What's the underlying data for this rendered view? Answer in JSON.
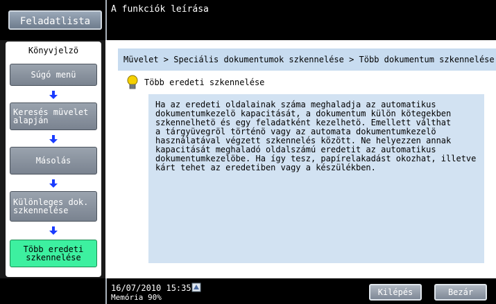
{
  "header": {
    "tasklist_label": "Feladatlista",
    "title": "A funkciók leírása"
  },
  "sidebar": {
    "bookmark_label": "Könyvjelzö",
    "items": [
      {
        "label": "Súgó menü"
      },
      {
        "label": "Keresés müvelet alapján"
      },
      {
        "label": "Másolás"
      },
      {
        "label": "Különleges dok. szkennelése"
      },
      {
        "label": "Több eredeti szkennelése"
      }
    ]
  },
  "main": {
    "breadcrumb": "Müvelet > Speciális dokumentumok szkennelése > Több dokumentum szkennelése",
    "topic_title": "Több eredeti szkennelése",
    "description": "Ha az eredeti oldalainak száma meghaladja az automatikus\ndokumentumkezelö kapacitását, a dokumentum külön kötegekben\nszkennelhetö és egy feladatként kezelhetö. Emellett válthat\na tárgyüvegröl történö vagy az automata dokumentumkezelö\nhasználatával végzett szkennelés között. Ne helyezzen annak\nkapacitását meghaladó oldalszámú eredetit az automatikus\ndokumentumkezelöbe. Ha így tesz, papírelakadást okozhat, illetve\nkárt tehet az eredetiben vagy a készülékben."
  },
  "footer": {
    "datetime": "16/07/2010   15:35",
    "memory": "Memória     90%",
    "exit_label": "Kilépés",
    "close_label": "Bezár"
  },
  "colors": {
    "active_nav": "#3df0a0",
    "breadcrumb_bg": "#c8dcf0",
    "description_bg": "#d2e2f2",
    "arrow_blue": "#1a3cff"
  },
  "icons": {
    "nav_arrow": "arrow-down-icon",
    "topic": "lightbulb-icon",
    "network": "network-icon"
  }
}
